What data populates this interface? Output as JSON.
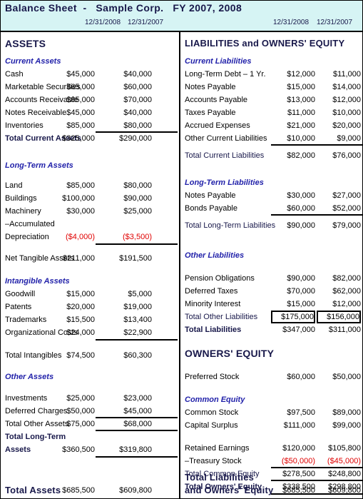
{
  "header": {
    "title": "Balance Sheet  -   Sample Corp.   FY 2007, 2008",
    "date_left_1": "12/31/2008",
    "date_left_2": "12/31/2007",
    "date_right_1": "12/31/2008",
    "date_right_2": "12/31/2007",
    "bg_color": "#d6f4f4",
    "accent_color": "#18184a",
    "negative_color": "#e00000"
  },
  "assets": {
    "heading": "ASSETS",
    "current": {
      "subheading": "Current Assets",
      "rows": [
        {
          "label": "Cash",
          "v1": "$45,000",
          "v2": "$40,000"
        },
        {
          "label": "Marketable Securities",
          "v1": "$65,000",
          "v2": "$60,000"
        },
        {
          "label": "Accounts Receivable",
          "v1": "$85,000",
          "v2": "$70,000"
        },
        {
          "label": "Notes Receivable",
          "v1": "$45,000",
          "v2": "$40,000"
        },
        {
          "label": "Inventories",
          "v1": "$85,000",
          "v2": "$80,000"
        }
      ],
      "total": {
        "label": "Total Current Assets",
        "v1": "$325,000",
        "v2": "$290,000"
      }
    },
    "long_term": {
      "subheading": "Long-Term Assets",
      "rows": [
        {
          "label": "Land",
          "v1": "$85,000",
          "v2": "$80,000"
        },
        {
          "label": "Buildings",
          "v1": "$100,000",
          "v2": "$90,000"
        },
        {
          "label": "Machinery",
          "v1": "$30,000",
          "v2": "$25,000"
        }
      ],
      "accum_dep_line1": "–Accumulated",
      "accum_dep_line2": "Depreciation",
      "accum_dep_v1": "($4,000)",
      "accum_dep_v2": "($3,500)",
      "net_tangible": {
        "label": "Net Tangible Assets",
        "v1": "$211,000",
        "v2": "$191,500"
      }
    },
    "intangible": {
      "subheading": "Intangible Assets",
      "rows": [
        {
          "label": "Goodwill",
          "v1": "$15,000",
          "v2": "$5,000"
        },
        {
          "label": "Patents",
          "v1": "$20,000",
          "v2": "$19,000"
        },
        {
          "label": "Trademarks",
          "v1": "$15,500",
          "v2": "$13,400"
        },
        {
          "label": "Organizational Costs",
          "v1": "$24,000",
          "v2": "$22,900"
        }
      ],
      "total": {
        "label": "Total Intangibles",
        "v1": "$74,500",
        "v2": "$60,300"
      }
    },
    "other": {
      "subheading": "Other Assets",
      "rows": [
        {
          "label": "Investments",
          "v1": "$25,000",
          "v2": "$23,000"
        },
        {
          "label": "Deferred Charges",
          "v1": "$50,000",
          "v2": "$45,000"
        }
      ],
      "total": {
        "label": "Total Other Assets",
        "v1": "$75,000",
        "v2": "$68,000"
      }
    },
    "total_long_term": {
      "label_line1": "Total Long-Term",
      "label_line2": "Assets",
      "v1": "$360,500",
      "v2": "$319,800"
    },
    "total_assets": {
      "label": "Total Assets",
      "v1": "$685,500",
      "v2": "$609,800"
    }
  },
  "liabilities": {
    "heading": "LIABILITIES and OWNERS' EQUITY",
    "current": {
      "subheading": "Current Liabilities",
      "rows": [
        {
          "label": "Long-Term Debt – 1 Yr.",
          "v1": "$12,000",
          "v2": "$11,000"
        },
        {
          "label": "Notes Payable",
          "v1": "$15,000",
          "v2": "$14,000"
        },
        {
          "label": "Accounts Payable",
          "v1": "$13,000",
          "v2": "$12,000"
        },
        {
          "label": "Taxes Payable",
          "v1": "$11,000",
          "v2": "$10,000"
        },
        {
          "label": "Accrued Expenses",
          "v1": "$21,000",
          "v2": "$20,000"
        },
        {
          "label": "Other Current Liabilities",
          "v1": "$10,000",
          "v2": "$9,000"
        }
      ],
      "total": {
        "label": "Total Current Liabilities",
        "v1": "$82,000",
        "v2": "$76,000"
      }
    },
    "long_term": {
      "subheading": "Long-Term Liabilities",
      "rows": [
        {
          "label": "Notes Payable",
          "v1": "$30,000",
          "v2": "$27,000"
        },
        {
          "label": "Bonds Payable",
          "v1": "$60,000",
          "v2": "$52,000"
        }
      ],
      "total": {
        "label": "Total Long-Term Liabilities",
        "v1": "$90,000",
        "v2": "$79,000"
      }
    },
    "other": {
      "subheading": "Other Liabilities",
      "rows": [
        {
          "label": "Pension Obligations",
          "v1": "$90,000",
          "v2": "$82,000"
        },
        {
          "label": "Deferred Taxes",
          "v1": "$70,000",
          "v2": "$62,000"
        },
        {
          "label": "Minority Interest",
          "v1": "$15,000",
          "v2": "$12,000"
        }
      ],
      "total": {
        "label": "Total Other Liabilities",
        "v1": "$175,000",
        "v2": "$156,000"
      }
    },
    "total_liabilities": {
      "label": "Total Liabilities",
      "v1": "$347,000",
      "v2": "$311,000"
    }
  },
  "owners_equity": {
    "heading": "OWNERS' EQUITY",
    "preferred_stock": {
      "label": "Preferred Stock",
      "v1": "$60,000",
      "v2": "$50,000"
    },
    "common": {
      "subheading": "Common Equity",
      "rows": [
        {
          "label": "Common Stock",
          "v1": "$97,500",
          "v2": "$89,000"
        },
        {
          "label": "Capital Surplus",
          "v1": "$111,000",
          "v2": "$99,000"
        }
      ],
      "retained_earnings": {
        "label": "Retained Earnings",
        "v1": "$120,000",
        "v2": "$105,800"
      },
      "treasury_stock": {
        "label": "–Treasury Stock",
        "v1": "($50,000)",
        "v2": "($45,000)"
      },
      "total_common": {
        "label": "Total Common Equity",
        "v1": "$278,500",
        "v2": "$248,800"
      }
    },
    "total_owners_equity": {
      "label": "Total Owners' Equity",
      "v1": "$338,500",
      "v2": "$298,800"
    },
    "grand_total": {
      "label_line1": "Total Liabilities",
      "label_line2": "and Owners' Equity",
      "v1": "$685,500",
      "v2": "$609,800"
    }
  }
}
